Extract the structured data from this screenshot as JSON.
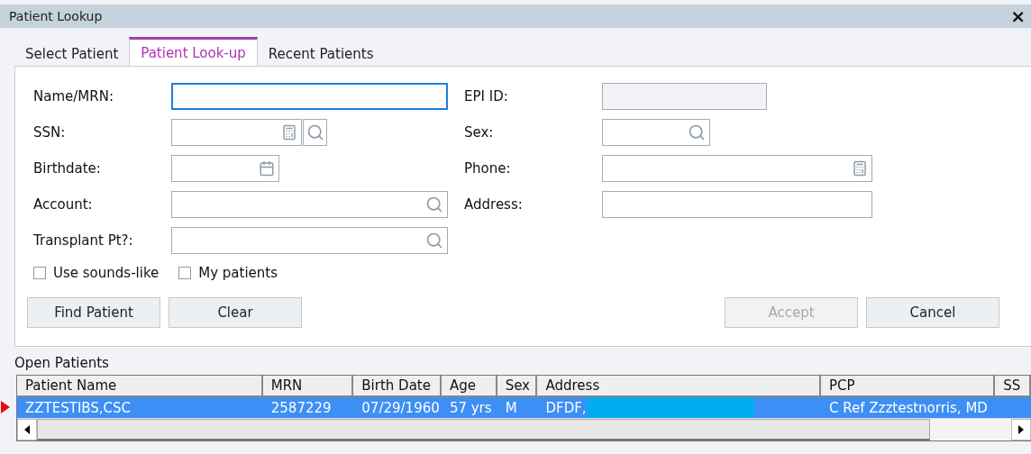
{
  "window": {
    "title": "Patient Lookup",
    "close": "×"
  },
  "tabs": [
    {
      "label": "Select Patient",
      "selected": false
    },
    {
      "label": "Patient Look-up",
      "selected": true
    },
    {
      "label": "Recent Patients",
      "selected": false
    }
  ],
  "left_fields": [
    {
      "label": "Name/MRN:",
      "focused": true
    },
    {
      "label": "SSN:",
      "focused": false
    },
    {
      "label": "Birthdate:",
      "focused": false
    },
    {
      "label": "Account:",
      "focused": false
    },
    {
      "label": "Transplant Pt?:",
      "focused": false
    }
  ],
  "right_fields": [
    {
      "label": "EPI ID:",
      "disabled": true
    },
    {
      "label": "Sex:",
      "disabled": false
    },
    {
      "label": "Phone:",
      "disabled": false
    },
    {
      "label": "Address:",
      "disabled": false
    }
  ],
  "checkboxes": [
    {
      "label": "Use sounds-like",
      "checked": false
    },
    {
      "label": "My patients",
      "checked": false
    }
  ],
  "left_buttons": [
    {
      "label": "Find Patient",
      "disabled": false
    },
    {
      "label": "Clear",
      "disabled": false
    }
  ],
  "right_buttons": [
    {
      "label": "Accept",
      "disabled": true
    },
    {
      "label": "Cancel",
      "disabled": false
    }
  ],
  "open_patients": {
    "title": "Open Patients",
    "columns": [
      "Patient Name",
      "MRN",
      "Birth Date",
      "Age",
      "Sex",
      "Address",
      "PCP",
      "SS"
    ],
    "rows": [
      {
        "selected": true,
        "cells": [
          "ZZTESTIBS,CSC",
          "2587229",
          "07/29/1960",
          "57 yrs",
          "M",
          "DFDF,",
          "C Ref Zzztestnorris, MD",
          ""
        ],
        "redacted": true
      }
    ]
  }
}
